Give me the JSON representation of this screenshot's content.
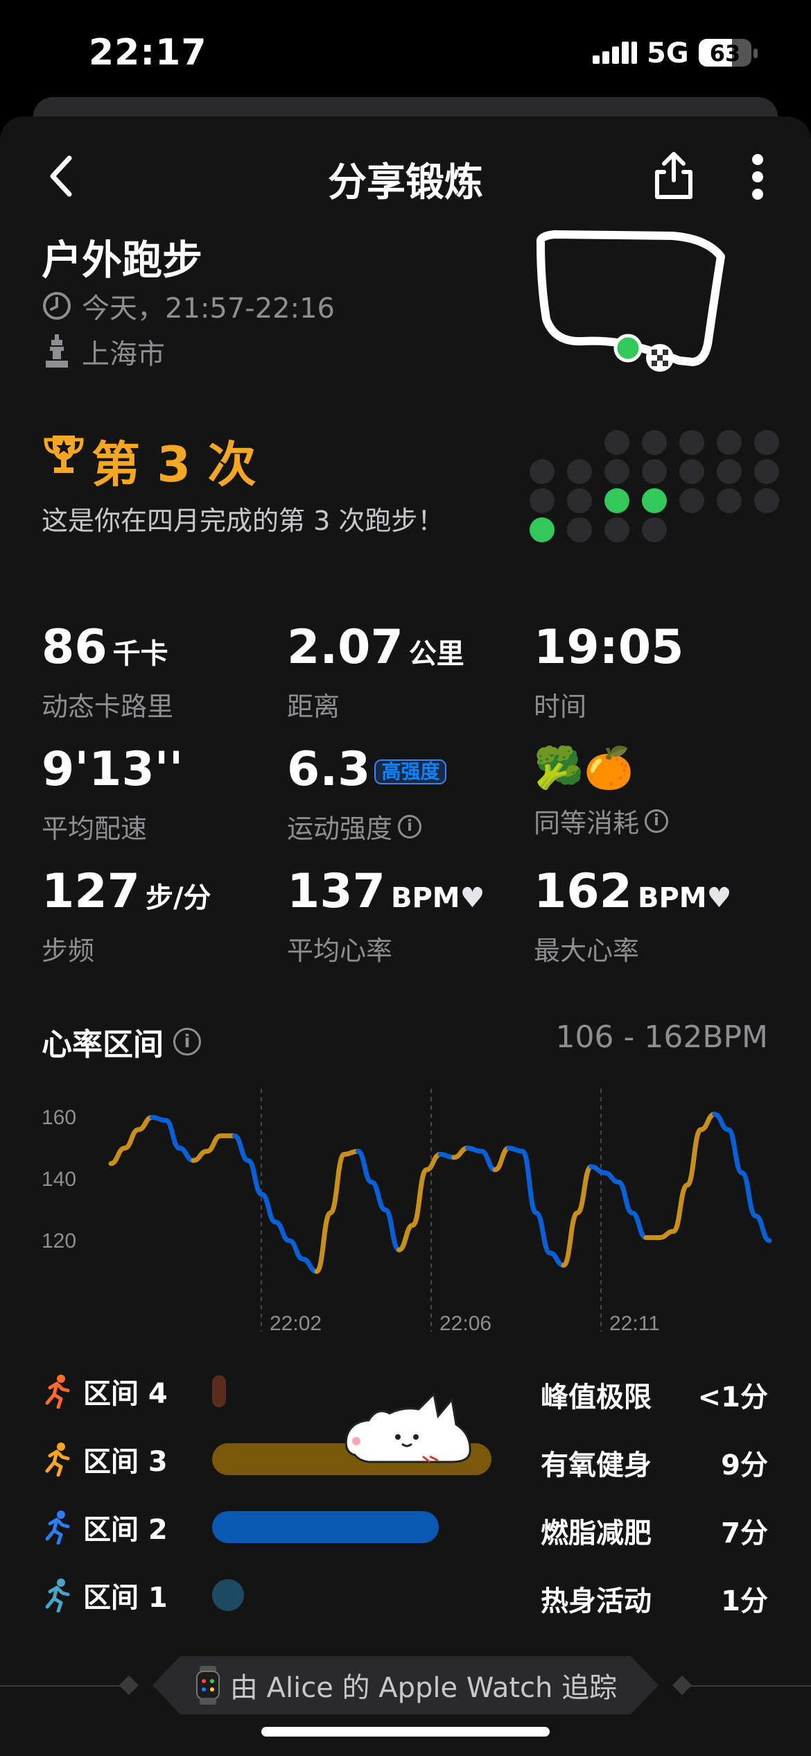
{
  "status_bar": {
    "time": "22:17",
    "network": "5G",
    "battery": "63",
    "battery_fraction": 0.63
  },
  "nav": {
    "title": "分享锻炼"
  },
  "workout": {
    "title": "户外跑步",
    "time_range": "今天，21:57-22:16",
    "location": "上海市"
  },
  "achievement": {
    "title": "第 3 次",
    "subtitle": "这是你在四月完成的第 3 次跑步！"
  },
  "calendar_dots": {
    "rows": [
      [
        0,
        0,
        0,
        0,
        0,
        0,
        0
      ],
      [
        0,
        0,
        0,
        0,
        0,
        0,
        0
      ],
      [
        0,
        0,
        1,
        1,
        0,
        0,
        0
      ],
      [
        1,
        0,
        0,
        0
      ]
    ],
    "first_row_start": 2
  },
  "stats": {
    "calories": {
      "value": "86",
      "unit": "千卡",
      "label": "动态卡路里"
    },
    "distance": {
      "value": "2.07",
      "unit": "公里",
      "label": "距离"
    },
    "duration": {
      "value": "19:05",
      "label": "时间"
    },
    "pace": {
      "value": "9'13''",
      "label": "平均配速"
    },
    "intensity": {
      "value": "6.3",
      "badge": "高强度",
      "label": "运动强度"
    },
    "equivalent": {
      "emoji": "🥦🍊",
      "label": "同等消耗"
    },
    "cadence": {
      "value": "127",
      "unit": "步/分",
      "label": "步频"
    },
    "avg_hr": {
      "value": "137",
      "unit": "BPM",
      "label": "平均心率"
    },
    "max_hr": {
      "value": "162",
      "unit": "BPM",
      "label": "最大心率"
    }
  },
  "heart_rate": {
    "title": "心率区间",
    "range": "106 - 162BPM"
  },
  "chart_data": {
    "type": "line",
    "y_ticks": [
      "160",
      "140",
      "120"
    ],
    "x_ticks": [
      "22:02",
      "22:06",
      "22:11"
    ],
    "ylim": [
      104,
      167
    ],
    "x": [
      0,
      1,
      2,
      3,
      4,
      5,
      6,
      7,
      8,
      9,
      10,
      11,
      12,
      13,
      14,
      15,
      16,
      17,
      18,
      19,
      20,
      21,
      22,
      23,
      24,
      25,
      26,
      27,
      28,
      29,
      30,
      31,
      32,
      33,
      34,
      35,
      36,
      37,
      38,
      39,
      40,
      41,
      42,
      43,
      44,
      45,
      46,
      47,
      48
    ],
    "values": [
      145,
      150,
      156,
      160,
      159,
      150,
      146,
      149,
      154,
      154,
      146,
      135,
      126,
      120,
      114,
      110,
      129,
      148,
      149,
      139,
      130,
      117,
      125,
      143,
      148,
      147,
      150,
      149,
      143,
      150,
      149,
      129,
      116,
      112,
      129,
      144,
      142,
      139,
      129,
      121,
      121,
      123,
      138,
      156,
      161,
      156,
      142,
      128,
      120
    ],
    "zone_colors": {
      "zone3": "#c8901b",
      "zone2": "#0a60d6"
    }
  },
  "zones": [
    {
      "label": "区间 4",
      "name": "峰值极限",
      "value": "<1分",
      "color": "#5a2e1c",
      "icon_color": "#ff6b2c",
      "fraction": 0.02
    },
    {
      "label": "区间 3",
      "name": "有氧健身",
      "value": "9分",
      "color": "#7a5a0a",
      "icon_color": "#f5a623",
      "fraction": 0.53
    },
    {
      "label": "区间 2",
      "name": "燃脂减肥",
      "value": "7分",
      "color": "#0a5ab4",
      "icon_color": "#2f7df6",
      "fraction": 0.43
    },
    {
      "label": "区间 1",
      "name": "热身活动",
      "value": "1分",
      "color": "#1f4a64",
      "icon_color": "#4aa3c8",
      "fraction": 0.06
    }
  ],
  "footer": {
    "text": "由 Alice 的 Apple Watch 追踪"
  }
}
